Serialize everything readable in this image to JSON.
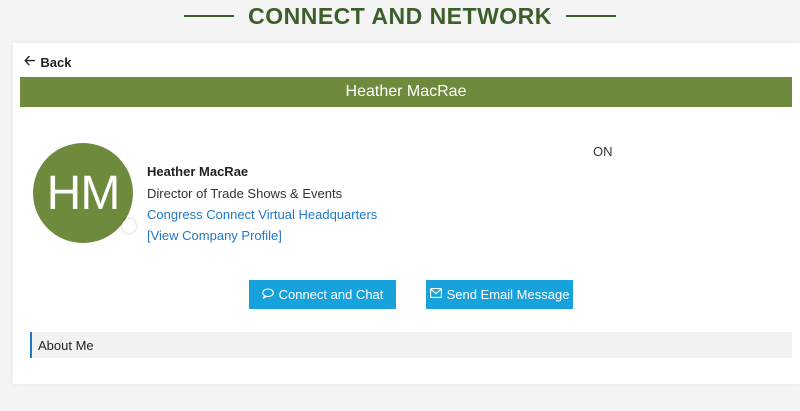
{
  "page": {
    "heading": "CONNECT AND NETWORK"
  },
  "nav": {
    "back_label": "Back"
  },
  "profile": {
    "header_name": "Heather MacRae",
    "initials": "HM",
    "name": "Heather MacRae",
    "job_title": "Director of Trade Shows & Events",
    "company": "Congress Connect Virtual Headquarters",
    "company_profile_link": "[View Company Profile]",
    "status": "ON"
  },
  "actions": {
    "connect_chat_label": "Connect and Chat",
    "send_email_label": "Send Email Message"
  },
  "sections": {
    "about_label": "About Me"
  },
  "colors": {
    "brand_green": "#6e8b3d",
    "heading_green": "#3b5e2b",
    "button_blue": "#17a2db",
    "link_blue": "#1f77c6"
  },
  "icons": {
    "back": "arrow-left-icon",
    "chat": "chat-bubble-icon",
    "email": "envelope-icon"
  }
}
